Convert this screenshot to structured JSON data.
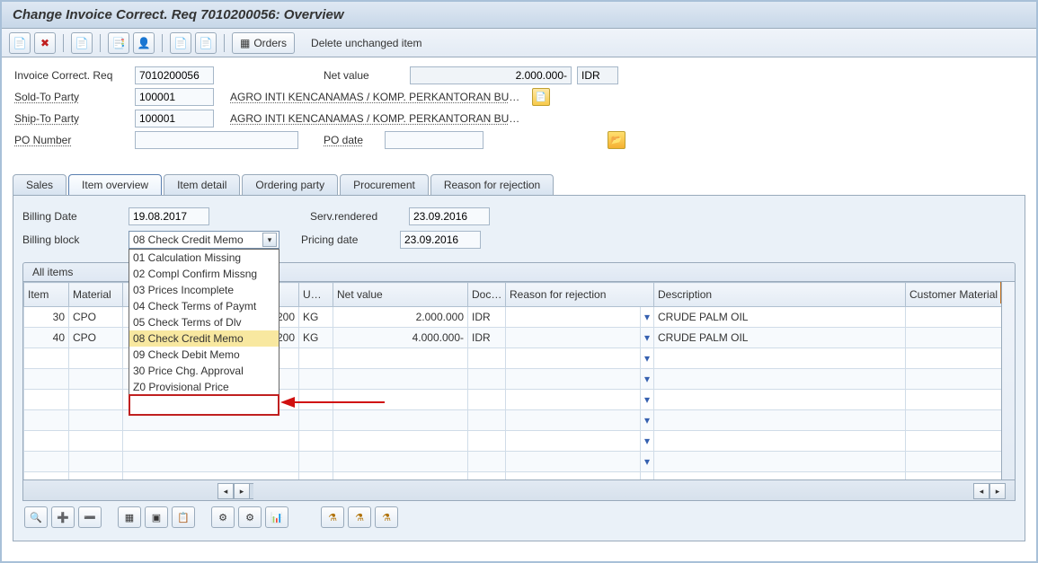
{
  "title": "Change Invoice Correct. Req 7010200056: Overview",
  "toolbar": {
    "orders_label": "Orders",
    "delete_label": "Delete unchanged item"
  },
  "header": {
    "doc_label": "Invoice Correct. Req",
    "doc_value": "7010200056",
    "netvalue_label": "Net value",
    "netvalue_value": "2.000.000-",
    "currency": "IDR",
    "sold_label": "Sold-To Party",
    "sold_value": "100001",
    "sold_desc": "AGRO INTI KENCANAMAS / KOMP. PERKANTORAN BUSINESS …",
    "ship_label": "Ship-To Party",
    "ship_value": "100001",
    "ship_desc": "AGRO INTI KENCANAMAS / KOMP. PERKANTORAN BUSINESS …",
    "po_label": "PO Number",
    "po_value": "",
    "podate_label": "PO date",
    "podate_value": ""
  },
  "tabs": [
    "Sales",
    "Item overview",
    "Item detail",
    "Ordering party",
    "Procurement",
    "Reason for rejection"
  ],
  "fields": {
    "billdate_label": "Billing Date",
    "billdate_value": "19.08.2017",
    "serv_label": "Serv.rendered",
    "serv_value": "23.09.2016",
    "block_label": "Billing block",
    "block_value": "08 Check Credit Memo",
    "pricingdate_label": "Pricing date",
    "pricingdate_value": "23.09.2016"
  },
  "block_options": [
    "01 Calculation Missing",
    "02 Compl Confirm Missng",
    "03 Prices Incomplete",
    "04 Check Terms of Paymt",
    "05 Check Terms of Dlv",
    "08 Check Credit Memo",
    "09 Check Debit Memo",
    "30 Price Chg. Approval",
    "Z0 Provisional Price"
  ],
  "grid_title": "All items",
  "grid_columns": {
    "item": "Item",
    "material": "Material",
    "qty": "",
    "uom": "U…",
    "netvalue": "Net value",
    "doc": "Doc…",
    "reason": "Reason for rejection",
    "desc": "Description",
    "cust": "Customer Material"
  },
  "grid_rows": [
    {
      "item": "30",
      "material": "CPO",
      "qty": "200",
      "uom": "KG",
      "netvalue": "2.000.000",
      "doc": "IDR",
      "reason": "",
      "desc": "CRUDE PALM OIL",
      "cust": ""
    },
    {
      "item": "40",
      "material": "CPO",
      "qty": "200",
      "uom": "KG",
      "netvalue": "4.000.000-",
      "doc": "IDR",
      "reason": "",
      "desc": "CRUDE PALM OIL",
      "cust": ""
    }
  ]
}
